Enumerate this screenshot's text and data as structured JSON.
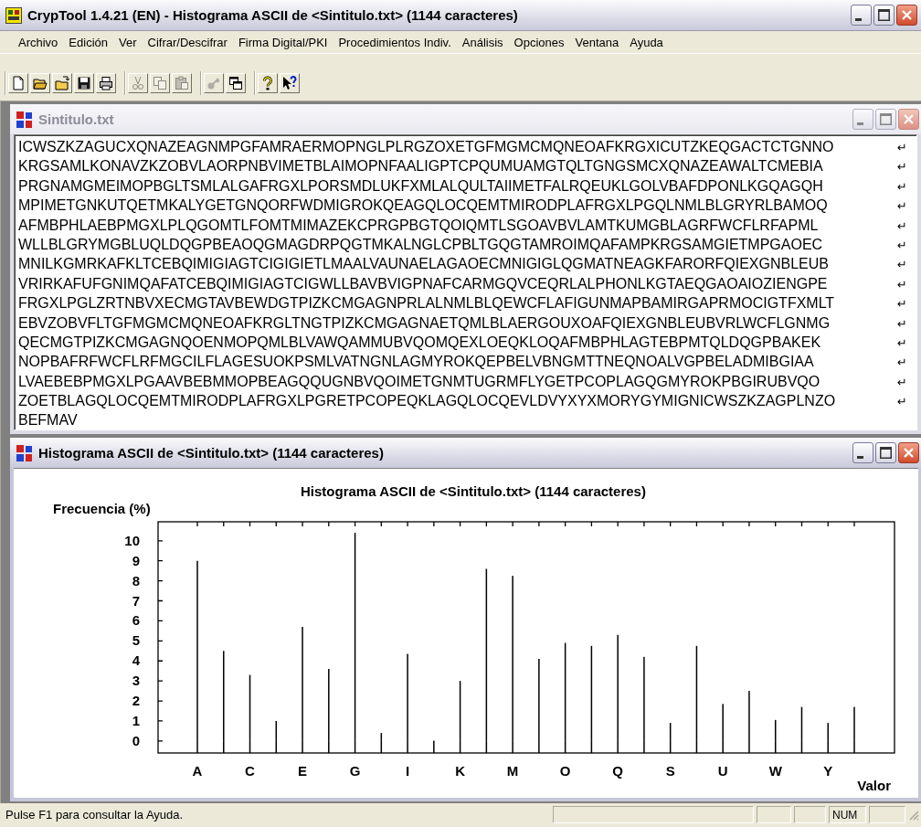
{
  "window": {
    "title": "CrypTool 1.4.21 (EN) - Histograma ASCII de <Sintitulo.txt> (1144 caracteres)"
  },
  "menu": [
    "Archivo",
    "Edición",
    "Ver",
    "Cifrar/Descifrar",
    "Firma Digital/PKI",
    "Procedimientos Indiv.",
    "Análisis",
    "Opciones",
    "Ventana",
    "Ayuda"
  ],
  "toolbar": [
    {
      "kind": "new",
      "disabled": false
    },
    {
      "kind": "open",
      "disabled": false
    },
    {
      "kind": "folder",
      "disabled": false
    },
    {
      "kind": "save",
      "disabled": false
    },
    {
      "kind": "print",
      "disabled": false
    },
    {
      "kind": "separator"
    },
    {
      "kind": "cut",
      "disabled": true
    },
    {
      "kind": "copy",
      "disabled": true
    },
    {
      "kind": "paste",
      "disabled": true
    },
    {
      "kind": "separator"
    },
    {
      "kind": "key",
      "disabled": true
    },
    {
      "kind": "windows",
      "disabled": false
    },
    {
      "kind": "separator"
    },
    {
      "kind": "help",
      "disabled": false
    },
    {
      "kind": "context-help",
      "disabled": false
    }
  ],
  "document": {
    "title": "Sintitulo.txt",
    "active": false,
    "lines": [
      {
        "text": "ICWSZKZAGUCXQNAZEAGNMPGFAMRAERMOPNGLPLRGZOXETGFMGMCMQNEOAFKRGXICUTZKEQGACTCTGNNO",
        "mark": "↵"
      },
      {
        "text": "KRGSAMLKONAVZKZOBVLAORPNBVIMETBLAIMOPNFAALIGPTCPQUMUAMGTQLTGNGSMCXQNAZEAWALTCMEBIA",
        "mark": "↵"
      },
      {
        "text": "PRGNAMGMEIMOPBGLTSMLALGAFRGXLPORSMDLUKFXMLALQULTAIIMETFALRQEUKLGOLVBAFDPONLKGQAGQH",
        "mark": "↵"
      },
      {
        "text": "MPIMETGNKUTQETMKALYGETGNQORFWDMIGROKQEAGQLOCQEMTMIRODPLAFRGXLPGQLNMLBLGRYRLBAMOQ",
        "mark": "↵"
      },
      {
        "text": "AFMBPHLAEBPMGXLPLQGOMTLFOMTMIMAZEKCPRGPBGTQOIQMTLSGOAVBVLAMTKUMGBLAGRFWCFLRFAPML",
        "mark": "↵"
      },
      {
        "text": "WLLBLGRYMGBLUQLDQGPBEAOQGMAGDRPQGTMKALNGLCPBLTGQGTAMROIMQAFAMPKRGSAMGIETMPGAOEC",
        "mark": "↵"
      },
      {
        "text": "MNILKGMRKAFKLTCEBQIMIGIAGTCIGIGIETLMAALVAUNAELAGAOECMNIGIGLQGMATNEAGKFARORFQIEXGNBLEUB",
        "mark": "↵"
      },
      {
        "text": "VRIRKAFUFGNIMQAFATCEBQIMIGIAGTCIGWLLBAVBVIGPNAFCARMGQVCEQRLALPHONLKGTAEQGAOAIOZIENGPE",
        "mark": "↵"
      },
      {
        "text": "FRGXLPGLZRTNBVXECMGTAVBEWDGTPIZKCMGAGNPRLALNMLBLQEWCFLAFIGUNMAPBAMIRGAPRMOCIGTFXMLT",
        "mark": "↵"
      },
      {
        "text": "EBVZOBVFLTGFMGMCMQNEOAFKRGLTNGTPIZKCMGAGNAETQMLBLAERGOUXOAFQIEXGNBLEUBVRLWCFLGNMG",
        "mark": "↵"
      },
      {
        "text": "QECMGTPIZKCMGAGNQOENMOPQMLBLVAWQAMMUBVQOMQEXLOEQKLOQAFMBPHLAGTEBPMTQLDQGPBAKEK",
        "mark": "↵"
      },
      {
        "text": "NOPBAFRFWCFLRFMGCILFLAGESUOKPSMLVATNGNLAGMYROKQEPBELVBNGMTTNEQNOALVGPBELADMIBGIAA",
        "mark": "↵"
      },
      {
        "text": "LVAEBEBPMGXLPGAAVBEBMMOPBEAGQQUGNBVQOIMETGNMTUGRMFLYGETPCOPLAGQGMYROKPBGIRUBVQO",
        "mark": "↵"
      },
      {
        "text": "ZOETBLAGQLOCQEMTMIRODPLAFRGXLPGRETPCOPEQKLAGQLOCQEVLDVYXYXMORYGYMIGNICWSZKZAGPLNZO",
        "mark": "↵"
      },
      {
        "text": "BEFMAV"
      }
    ]
  },
  "histogram_window": {
    "title": "Histograma ASCII de <Sintitulo.txt> (1144 caracteres)",
    "active": true,
    "chart_data": {
      "type": "bar",
      "title": "Histograma ASCII de <Sintitulo.txt> (1144 caracteres)",
      "xlabel": "Valor",
      "ylabel": "Frecuencia (%)",
      "categories": [
        "A",
        null,
        "C",
        null,
        "E",
        null,
        "G",
        null,
        "I",
        null,
        "K",
        null,
        "M",
        null,
        "O",
        null,
        "Q",
        null,
        "S",
        null,
        "U",
        null,
        "W",
        null,
        "Y",
        null
      ],
      "values": [
        9.0,
        4.5,
        3.3,
        1.0,
        5.7,
        3.6,
        10.4,
        0.4,
        4.35,
        0.0,
        3.0,
        8.6,
        8.25,
        4.1,
        4.9,
        4.75,
        5.3,
        4.2,
        0.9,
        4.75,
        1.85,
        2.5,
        1.05,
        1.7,
        0.9,
        1.7
      ],
      "yticks": [
        0,
        1,
        2,
        3,
        4,
        5,
        6,
        7,
        8,
        9,
        10
      ],
      "ylim": [
        -0.6,
        10.95
      ]
    }
  },
  "status_bar": {
    "message": "Pulse F1 para consultar la Ayuda.",
    "num_indicator": "NUM"
  }
}
